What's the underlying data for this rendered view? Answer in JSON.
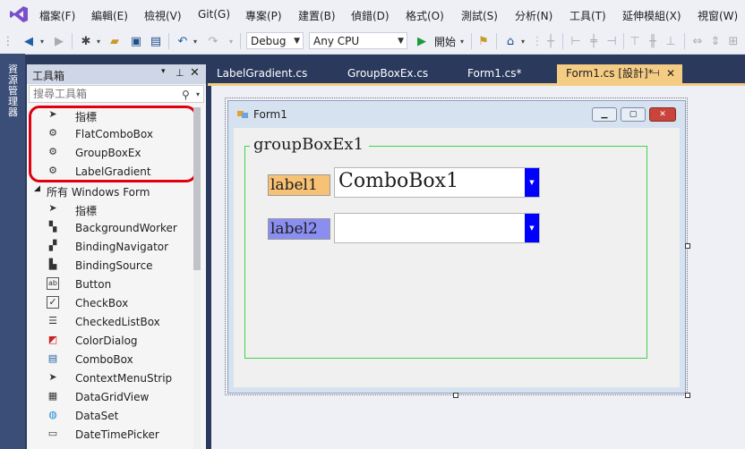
{
  "menu": [
    "檔案(F)",
    "編輯(E)",
    "檢視(V)",
    "Git(G)",
    "專案(P)",
    "建置(B)",
    "偵錯(D)",
    "格式(O)",
    "測試(S)",
    "分析(N)",
    "工具(T)",
    "延伸模組(X)",
    "視窗(W)"
  ],
  "toolbar": {
    "config": "Debug",
    "platform": "Any CPU",
    "start_label": "開始"
  },
  "leftstrip": {
    "label": "資源管理器"
  },
  "toolbox": {
    "title": "工具箱",
    "search_placeholder": "搜尋工具箱",
    "custom_items": [
      {
        "icon": "pointer-icon",
        "label": "指標"
      },
      {
        "icon": "component-icon",
        "label": "FlatComboBox"
      },
      {
        "icon": "component-icon",
        "label": "GroupBoxEx"
      },
      {
        "icon": "component-icon",
        "label": "LabelGradient"
      }
    ],
    "section_title": "所有 Windows Form",
    "items": [
      {
        "icon": "pointer-icon",
        "label": "指標"
      },
      {
        "icon": "backgroundworker-icon",
        "label": "BackgroundWorker"
      },
      {
        "icon": "bindingnavigator-icon",
        "label": "BindingNavigator"
      },
      {
        "icon": "bindingsource-icon",
        "label": "BindingSource"
      },
      {
        "icon": "button-icon",
        "label": "Button"
      },
      {
        "icon": "checkbox-icon",
        "label": "CheckBox"
      },
      {
        "icon": "checkedlistbox-icon",
        "label": "CheckedListBox"
      },
      {
        "icon": "colordialog-icon",
        "label": "ColorDialog"
      },
      {
        "icon": "combobox-icon",
        "label": "ComboBox"
      },
      {
        "icon": "contextmenustrip-icon",
        "label": "ContextMenuStrip"
      },
      {
        "icon": "datagridview-icon",
        "label": "DataGridView"
      },
      {
        "icon": "dataset-icon",
        "label": "DataSet"
      },
      {
        "icon": "datetimepicker-icon",
        "label": "DateTimePicker"
      }
    ]
  },
  "tabs": [
    {
      "label": "LabelGradient.cs",
      "active": false
    },
    {
      "label": "GroupBoxEx.cs",
      "active": false
    },
    {
      "label": "Form1.cs*",
      "active": false
    },
    {
      "label": "Form1.cs [設計]*",
      "active": true
    }
  ],
  "form": {
    "title": "Form1",
    "groupbox_title": "groupBoxEx1",
    "label1": "label1",
    "label2": "label2",
    "combobox1_value": "ComboBox1",
    "combobox2_value": ""
  },
  "colors": {
    "accent": "#f5cc84",
    "highlight": "#e0000f",
    "groupbox_border": "#3fd24e",
    "label1_bg": "#f7c276",
    "label2_bg": "#8a8ef0",
    "dropdown": "#0000ff"
  }
}
